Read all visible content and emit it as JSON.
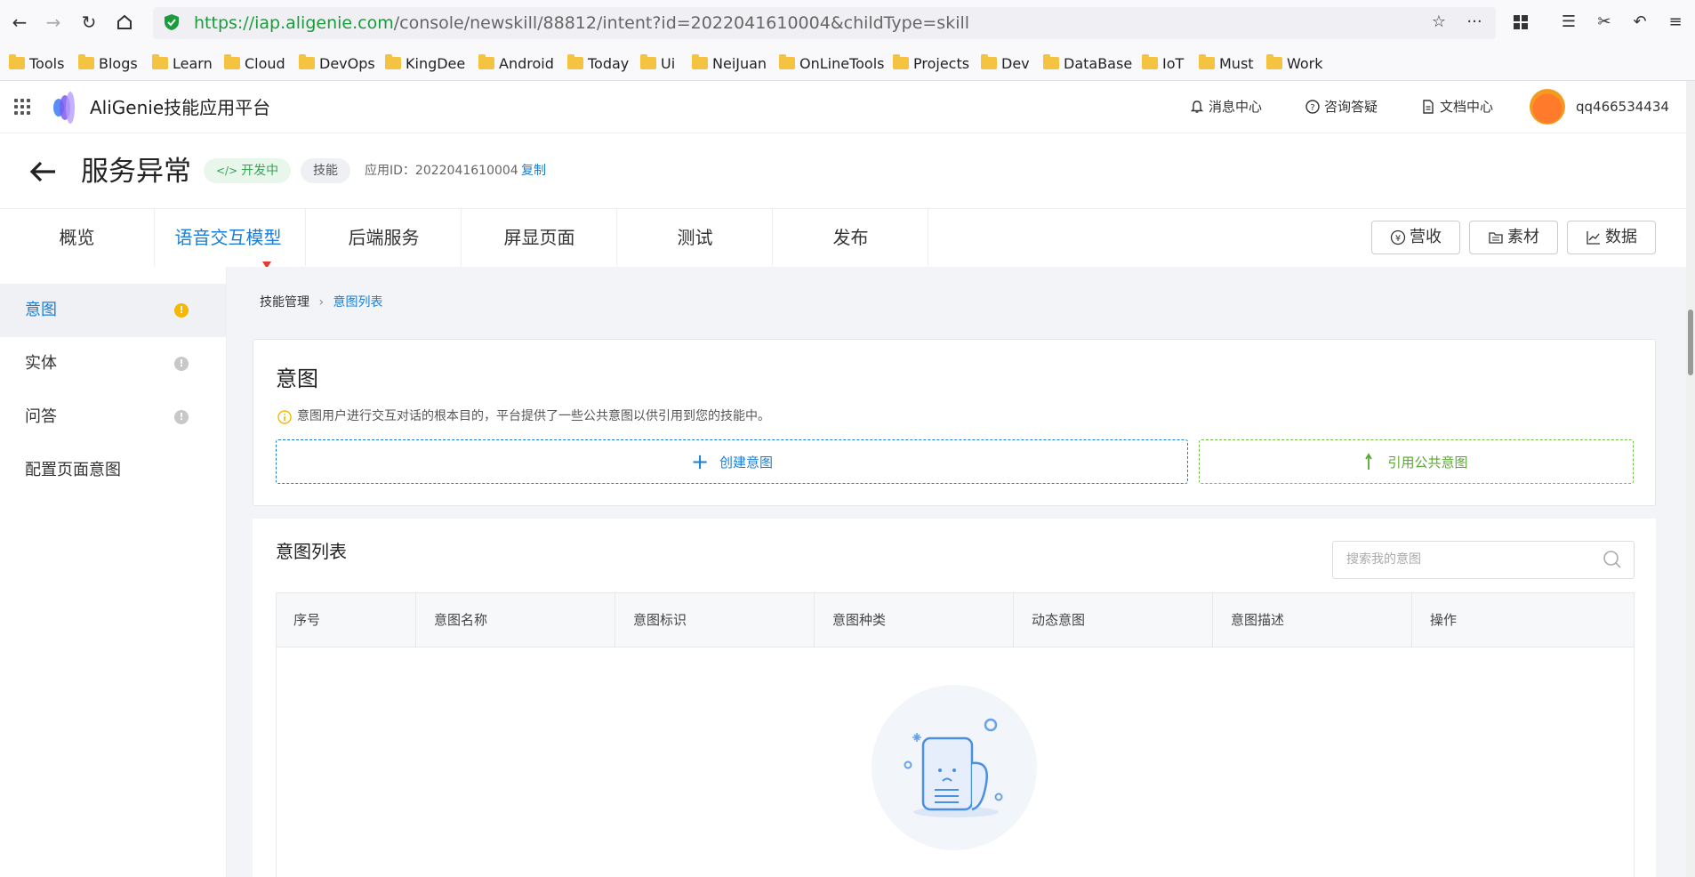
{
  "browser": {
    "url_scheme": "https://",
    "url_host": "iap.aligenie.com",
    "url_path": "/console/newskill/88812/intent?id=2022041610004&childType=skill",
    "bookmarks": [
      "Tools",
      "Blogs",
      "Learn",
      "Cloud",
      "DevOps",
      "KingDee",
      "Android",
      "Today",
      "Ui",
      "NeiJuan",
      "OnLineTools",
      "Projects",
      "Dev",
      "DataBase",
      "IoT",
      "Must",
      "Work"
    ]
  },
  "header": {
    "app_title": "AliGenie技能应用平台",
    "messages": "消息中心",
    "consult": "咨询答疑",
    "docs": "文档中心",
    "username": "qq466534434"
  },
  "page": {
    "title": "服务异常",
    "status_tag": "开发中",
    "type_tag": "技能",
    "app_id": "应用ID：2022041610004",
    "copy": "复制"
  },
  "tabs": [
    "概览",
    "语音交互模型",
    "后端服务",
    "屏显页面",
    "测试",
    "发布"
  ],
  "right_buttons": {
    "revenue": "营收",
    "material": "素材",
    "data": "数据"
  },
  "sidebar": {
    "items": [
      {
        "label": "意图"
      },
      {
        "label": "实体"
      },
      {
        "label": "问答"
      },
      {
        "label": "配置页面意图"
      }
    ]
  },
  "breadcrumb": {
    "root": "技能管理",
    "current": "意图列表"
  },
  "intent_card": {
    "title": "意图",
    "info": "意图用户进行交互对话的根本目的，平台提供了一些公共意图以供引用到您的技能中。",
    "create": "创建意图",
    "reference": "引用公共意图"
  },
  "list": {
    "title": "意图列表",
    "search_placeholder": "搜索我的意图",
    "columns": [
      "序号",
      "意图名称",
      "意图标识",
      "意图种类",
      "动态意图",
      "意图描述",
      "操作"
    ]
  },
  "colors": {
    "accent": "#1a7ed6",
    "success": "#33a552",
    "warning": "#f5b800",
    "muted": "#bbbbbb"
  }
}
